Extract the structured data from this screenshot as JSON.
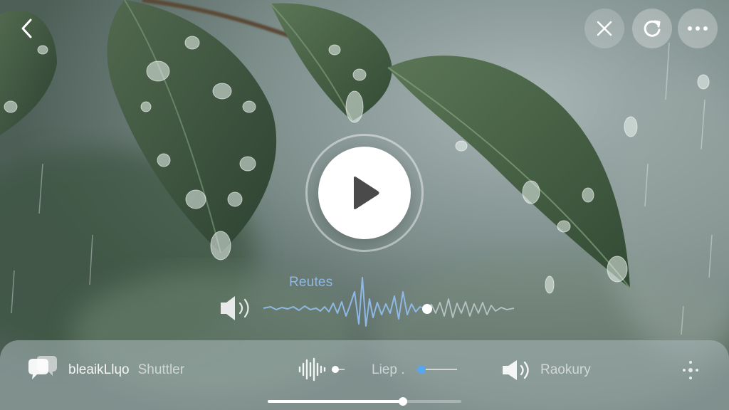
{
  "header": {
    "back_icon": "chevron-left-icon",
    "close_icon": "close-icon",
    "refresh_icon": "refresh-icon",
    "more_icon": "more-horizontal-icon"
  },
  "player": {
    "play_icon": "play-icon",
    "waveform_title": "Reutes",
    "volume_icon": "speaker-icon"
  },
  "bottom_bar": {
    "chat_icon": "chat-bubbles-icon",
    "name": "bleaikLlɥo",
    "sub": "Shuttler",
    "eq_icon": "equalizer-icon",
    "mode": "Liep .",
    "sound_icon": "speaker-icon",
    "sound_label": "Raokury",
    "settings_icon": "sparkle-dots-icon",
    "progress": 0.7,
    "mode_slider": 0.0
  },
  "colors": {
    "wave_accent": "#8fb8e4",
    "wave_dim": "#c9d2d8",
    "slider_dot": "#5aa6ec"
  }
}
